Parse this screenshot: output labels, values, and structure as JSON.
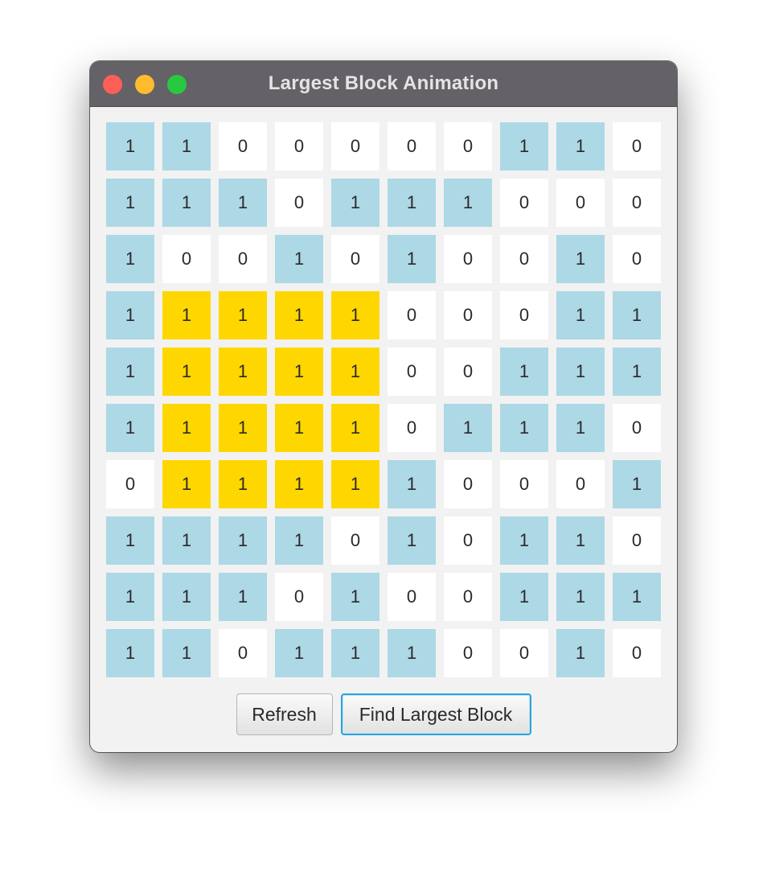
{
  "window": {
    "title": "Largest Block Animation"
  },
  "colors": {
    "one": "#add8e6",
    "zero": "#ffffff",
    "highlight": "#ffd700"
  },
  "grid": {
    "rows": [
      [
        "1",
        "1",
        "0",
        "0",
        "0",
        "0",
        "0",
        "1",
        "1",
        "0"
      ],
      [
        "1",
        "1",
        "1",
        "0",
        "1",
        "1",
        "1",
        "0",
        "0",
        "0"
      ],
      [
        "1",
        "0",
        "0",
        "1",
        "0",
        "1",
        "0",
        "0",
        "1",
        "0"
      ],
      [
        "1",
        "1",
        "1",
        "1",
        "1",
        "0",
        "0",
        "0",
        "1",
        "1"
      ],
      [
        "1",
        "1",
        "1",
        "1",
        "1",
        "0",
        "0",
        "1",
        "1",
        "1"
      ],
      [
        "1",
        "1",
        "1",
        "1",
        "1",
        "0",
        "1",
        "1",
        "1",
        "0"
      ],
      [
        "0",
        "1",
        "1",
        "1",
        "1",
        "1",
        "0",
        "0",
        "0",
        "1"
      ],
      [
        "1",
        "1",
        "1",
        "1",
        "0",
        "1",
        "0",
        "1",
        "1",
        "0"
      ],
      [
        "1",
        "1",
        "1",
        "0",
        "1",
        "0",
        "0",
        "1",
        "1",
        "1"
      ],
      [
        "1",
        "1",
        "0",
        "1",
        "1",
        "1",
        "0",
        "0",
        "1",
        "0"
      ]
    ],
    "highlighted_block": {
      "rows": [
        3,
        4,
        5,
        6
      ],
      "cols": [
        1,
        2,
        3,
        4
      ]
    }
  },
  "buttons": {
    "refresh_label": "Refresh",
    "find_label": "Find Largest Block"
  }
}
